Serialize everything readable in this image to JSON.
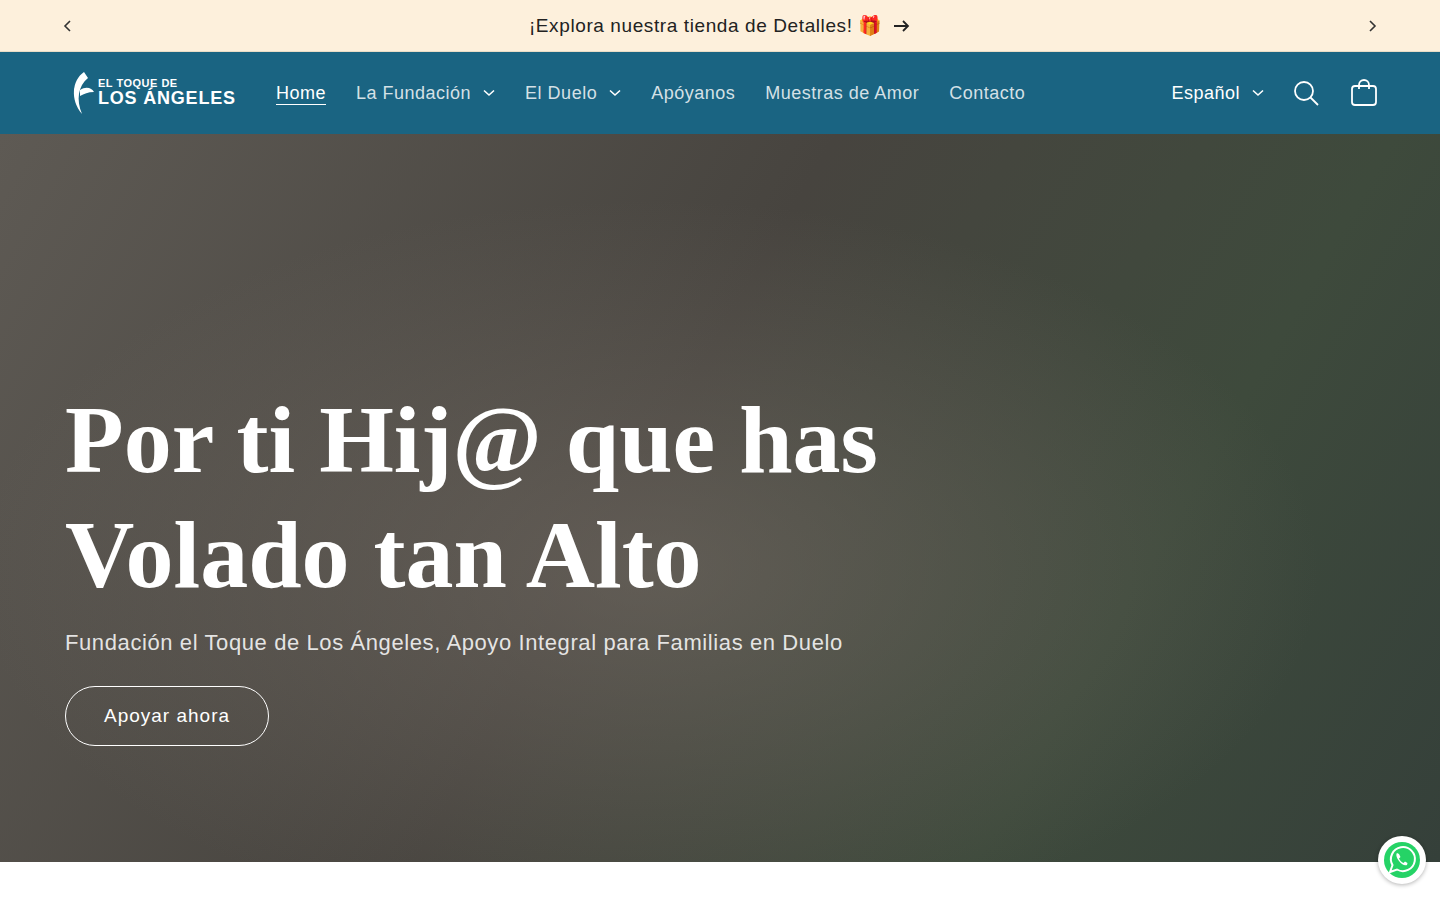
{
  "announcement": {
    "text": "¡Explora nuestra tienda de Detalles! 🎁"
  },
  "logo": {
    "line1": "EL TOQUE DE",
    "line2": "LOS ÁNGELES"
  },
  "nav": {
    "items": [
      {
        "label": "Home",
        "selected": true,
        "dropdown": false
      },
      {
        "label": "La Fundación",
        "selected": false,
        "dropdown": true
      },
      {
        "label": "El Duelo",
        "selected": false,
        "dropdown": true
      },
      {
        "label": "Apóyanos",
        "selected": false,
        "dropdown": false
      },
      {
        "label": "Muestras de Amor",
        "selected": false,
        "dropdown": false
      },
      {
        "label": "Contacto",
        "selected": false,
        "dropdown": false
      }
    ]
  },
  "language": {
    "label": "Español"
  },
  "hero": {
    "title": "Por ti Hij@ que has Volado tan Alto",
    "subtitle": "Fundación el Toque de Los Ángeles, Apoyo Integral para Familias en Duelo",
    "button": "Apoyar ahora"
  }
}
